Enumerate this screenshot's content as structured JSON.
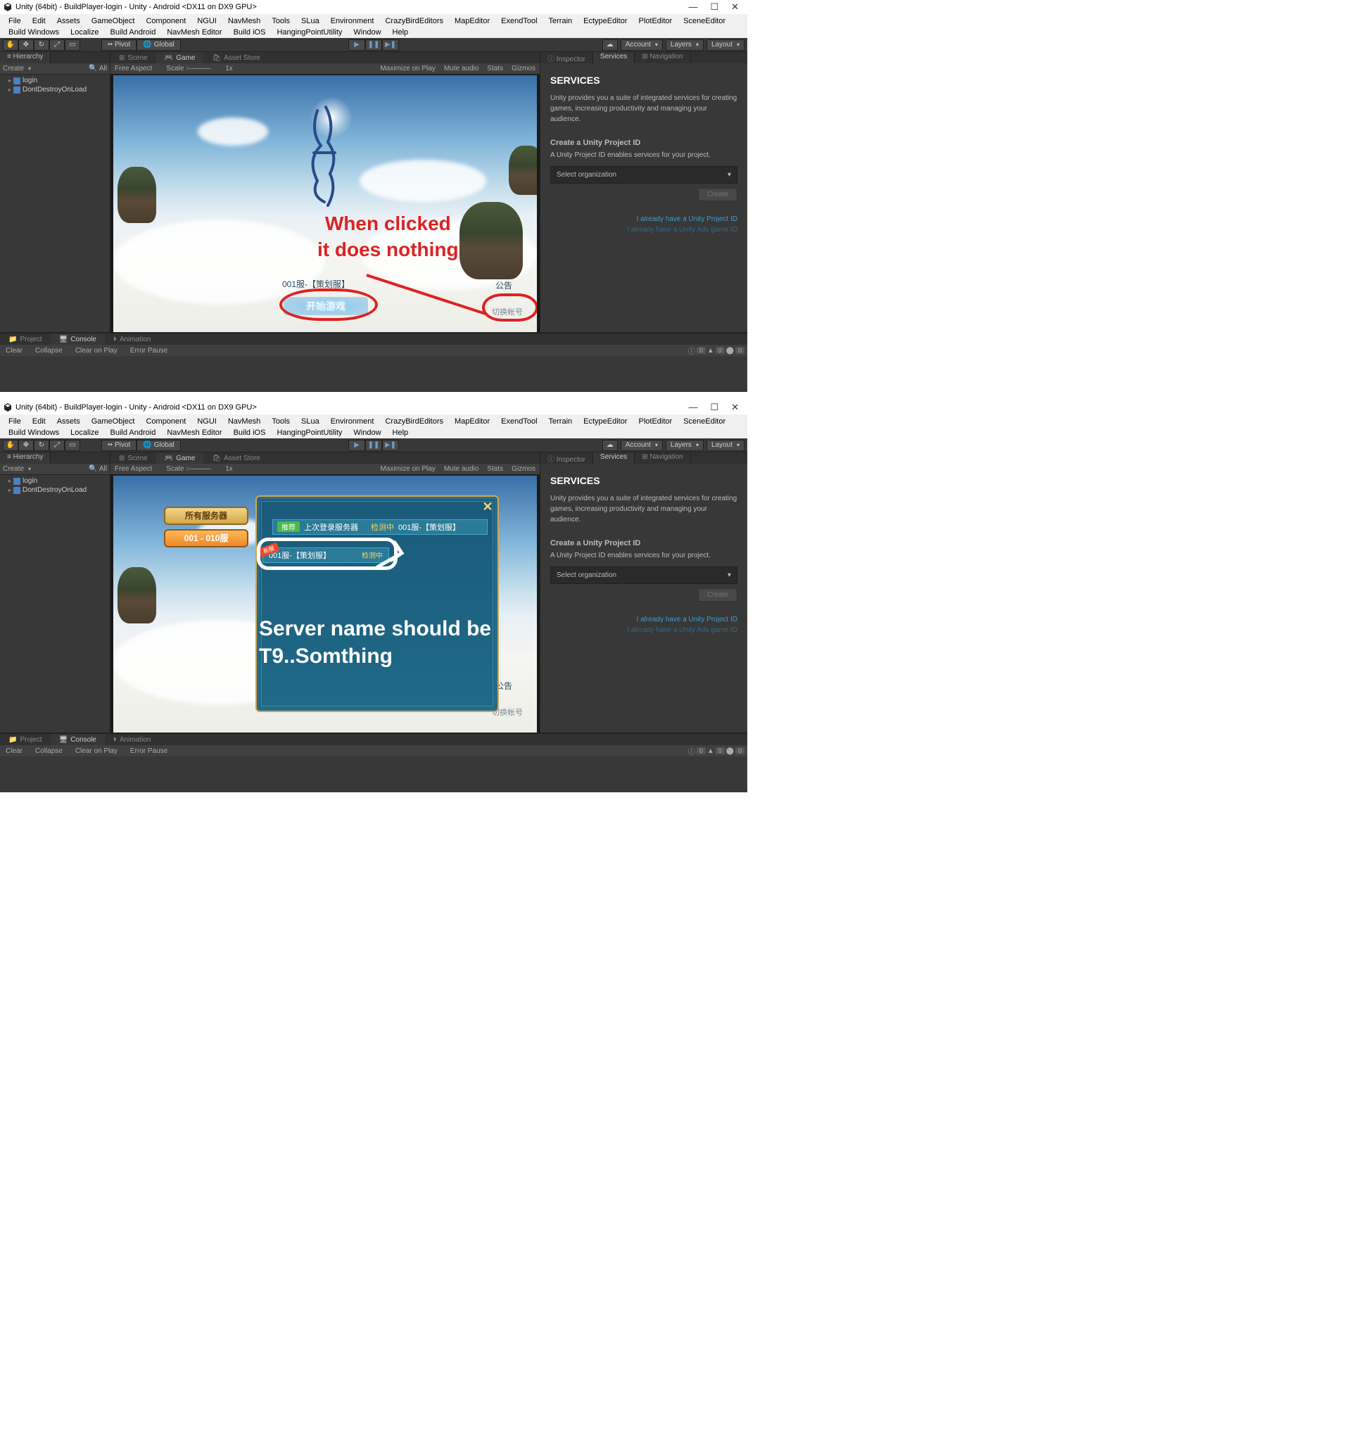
{
  "title": "Unity (64bit) - BuildPlayer-login - Unity - Android <DX11 on DX9 GPU>",
  "menubar": [
    "File",
    "Edit",
    "Assets",
    "GameObject",
    "Component",
    "NGUI",
    "NavMesh",
    "Tools",
    "SLua",
    "Environment",
    "CrazyBirdEditors",
    "MapEditor",
    "ExendTool",
    "Terrain",
    "EctypeEditor",
    "PlotEditor",
    "SceneEditor",
    "Build Windows",
    "Localize",
    "Build Android",
    "NavMesh Editor",
    "Build iOS",
    "HangingPointUtility",
    "Window",
    "Help"
  ],
  "toolbar": {
    "pivot": "Pivot",
    "global": "Global",
    "account": "Account",
    "layers": "Layers",
    "layout": "Layout"
  },
  "hierarchy": {
    "tab": "Hierarchy",
    "create": "Create",
    "all": "All",
    "items": [
      "login",
      "DontDestroyOnLoad"
    ]
  },
  "view_tabs": {
    "scene": "Scene",
    "game": "Game",
    "asset": "Asset Store"
  },
  "view_bar": {
    "aspect": "Free Aspect",
    "scale": "Scale",
    "scale_val": "1x",
    "maximize": "Maximize on Play",
    "mute": "Mute audio",
    "stats": "Stats",
    "gizmos": "Gizmos"
  },
  "right_tabs": {
    "inspector": "Inspector",
    "services": "Services",
    "nav": "Navigation"
  },
  "services": {
    "title": "SERVICES",
    "desc": "Unity provides you a suite of integrated services for creating games, increasing productivity and managing your audience.",
    "sub": "Create a Unity Project ID",
    "sub2": "A Unity Project ID enables services for your project.",
    "select": "Select organization",
    "create": "Create",
    "link1": "I already have a Unity Project ID",
    "link2": "I already have a Unity Ads game ID"
  },
  "bottom_tabs": {
    "project": "Project",
    "console": "Console",
    "animation": "Animation"
  },
  "console_bar": {
    "clear": "Clear",
    "collapse": "Collapse",
    "clearplay": "Clear on Play",
    "errorpause": "Error Pause",
    "info": "0",
    "warn": "0",
    "err": "0"
  },
  "game1": {
    "server_line": "001服-【策划服】",
    "start": "开始游戏",
    "gonggao": "公告",
    "switch": "切换帐号",
    "annotation": "When clicked\nit does nothing"
  },
  "game2": {
    "all_servers": "所有服务器",
    "range": "001 - 010服",
    "recommend": "推荐",
    "last_login": "上次登录服务器",
    "checking": "检测中",
    "server1_full": "001服-【策划服】",
    "server1_name": "001服-【策划服】",
    "server1_status": "检测中",
    "new": "新服",
    "gonggao": "公告",
    "switch": "切换帐号",
    "annotation": "Server name should be\nT9..Somthing"
  }
}
